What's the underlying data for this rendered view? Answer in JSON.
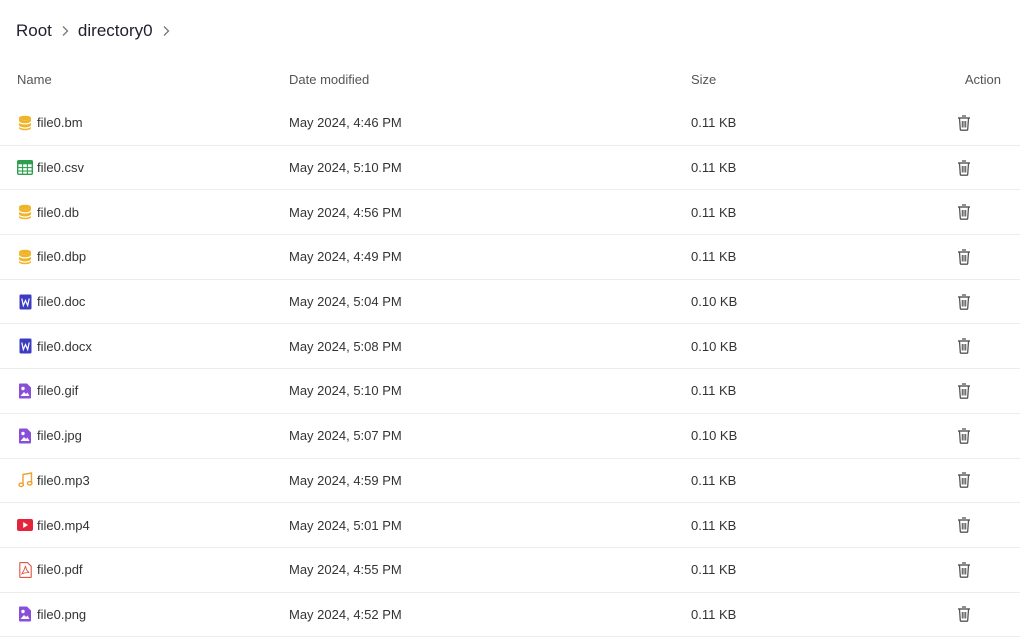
{
  "breadcrumb": {
    "items": [
      "Root",
      "directory0"
    ]
  },
  "table": {
    "headers": {
      "name": "Name",
      "date": "Date modified",
      "size": "Size",
      "action": "Action"
    },
    "rows": [
      {
        "name": "file0.bm",
        "date": "May 2024, 4:46 PM",
        "size": "0.11 KB",
        "icon": "database-icon"
      },
      {
        "name": "file0.csv",
        "date": "May 2024, 5:10 PM",
        "size": "0.11 KB",
        "icon": "spreadsheet-icon"
      },
      {
        "name": "file0.db",
        "date": "May 2024, 4:56 PM",
        "size": "0.11 KB",
        "icon": "database-icon"
      },
      {
        "name": "file0.dbp",
        "date": "May 2024, 4:49 PM",
        "size": "0.11 KB",
        "icon": "database-icon"
      },
      {
        "name": "file0.doc",
        "date": "May 2024, 5:04 PM",
        "size": "0.10 KB",
        "icon": "word-doc-icon"
      },
      {
        "name": "file0.docx",
        "date": "May 2024, 5:08 PM",
        "size": "0.10 KB",
        "icon": "word-doc-icon"
      },
      {
        "name": "file0.gif",
        "date": "May 2024, 5:10 PM",
        "size": "0.11 KB",
        "icon": "image-file-icon"
      },
      {
        "name": "file0.jpg",
        "date": "May 2024, 5:07 PM",
        "size": "0.10 KB",
        "icon": "image-file-icon"
      },
      {
        "name": "file0.mp3",
        "date": "May 2024, 4:59 PM",
        "size": "0.11 KB",
        "icon": "music-note-icon"
      },
      {
        "name": "file0.mp4",
        "date": "May 2024, 5:01 PM",
        "size": "0.11 KB",
        "icon": "video-play-icon"
      },
      {
        "name": "file0.pdf",
        "date": "May 2024, 4:55 PM",
        "size": "0.11 KB",
        "icon": "pdf-icon"
      },
      {
        "name": "file0.png",
        "date": "May 2024, 4:52 PM",
        "size": "0.11 KB",
        "icon": "image-file-icon"
      }
    ]
  },
  "colors": {
    "database": "#f0b429",
    "spreadsheet": "#2e9e4f",
    "word": "#3b3bc4",
    "image": "#8a4fd8",
    "music": "#f0a030",
    "video": "#e5243b",
    "pdf": "#e05545",
    "trash": "#555555",
    "divider": "#ececec"
  }
}
